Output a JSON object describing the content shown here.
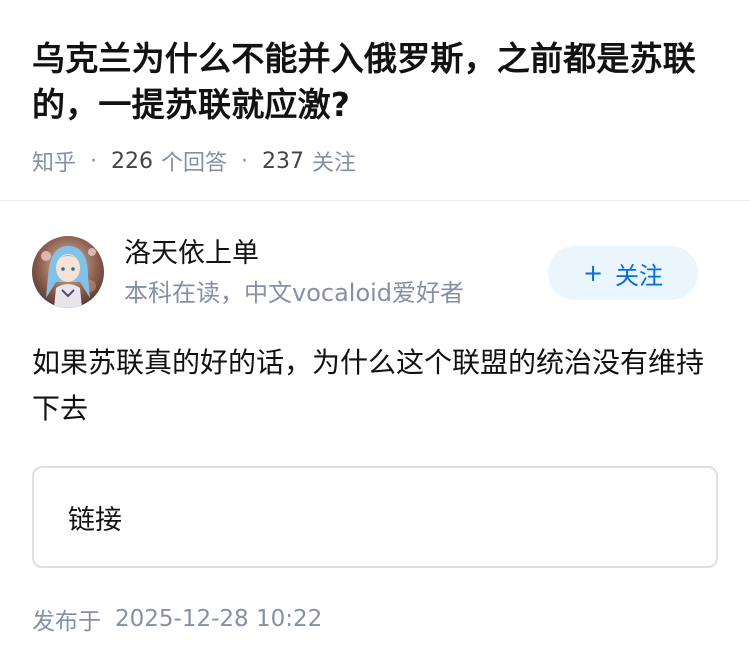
{
  "question": {
    "title": "乌克兰为什么不能并入俄罗斯，之前都是苏联的，一提苏联就应激?",
    "source": "知乎",
    "answer_count": "226",
    "answer_label": "个回答",
    "follower_count": "237",
    "follower_label": "关注",
    "separator": "·"
  },
  "author": {
    "name": "洛天依上单",
    "bio": "本科在读，中文vocaloid爱好者",
    "avatar_icon": "anime-avatar-icon"
  },
  "follow_button": {
    "plus": "+",
    "label": "关注"
  },
  "answer": {
    "text": "如果苏联真的好的话，为什么这个联盟的统治没有维持下去"
  },
  "link_card": {
    "label": "链接"
  },
  "publish": {
    "label": "发布于",
    "datetime": "2025-12-28 10:22"
  },
  "colors": {
    "title": "#121212",
    "meta": "#8590a6",
    "accent": "#056de8",
    "follow_bg": "#ebf5fd",
    "border": "#dcdfe4"
  }
}
